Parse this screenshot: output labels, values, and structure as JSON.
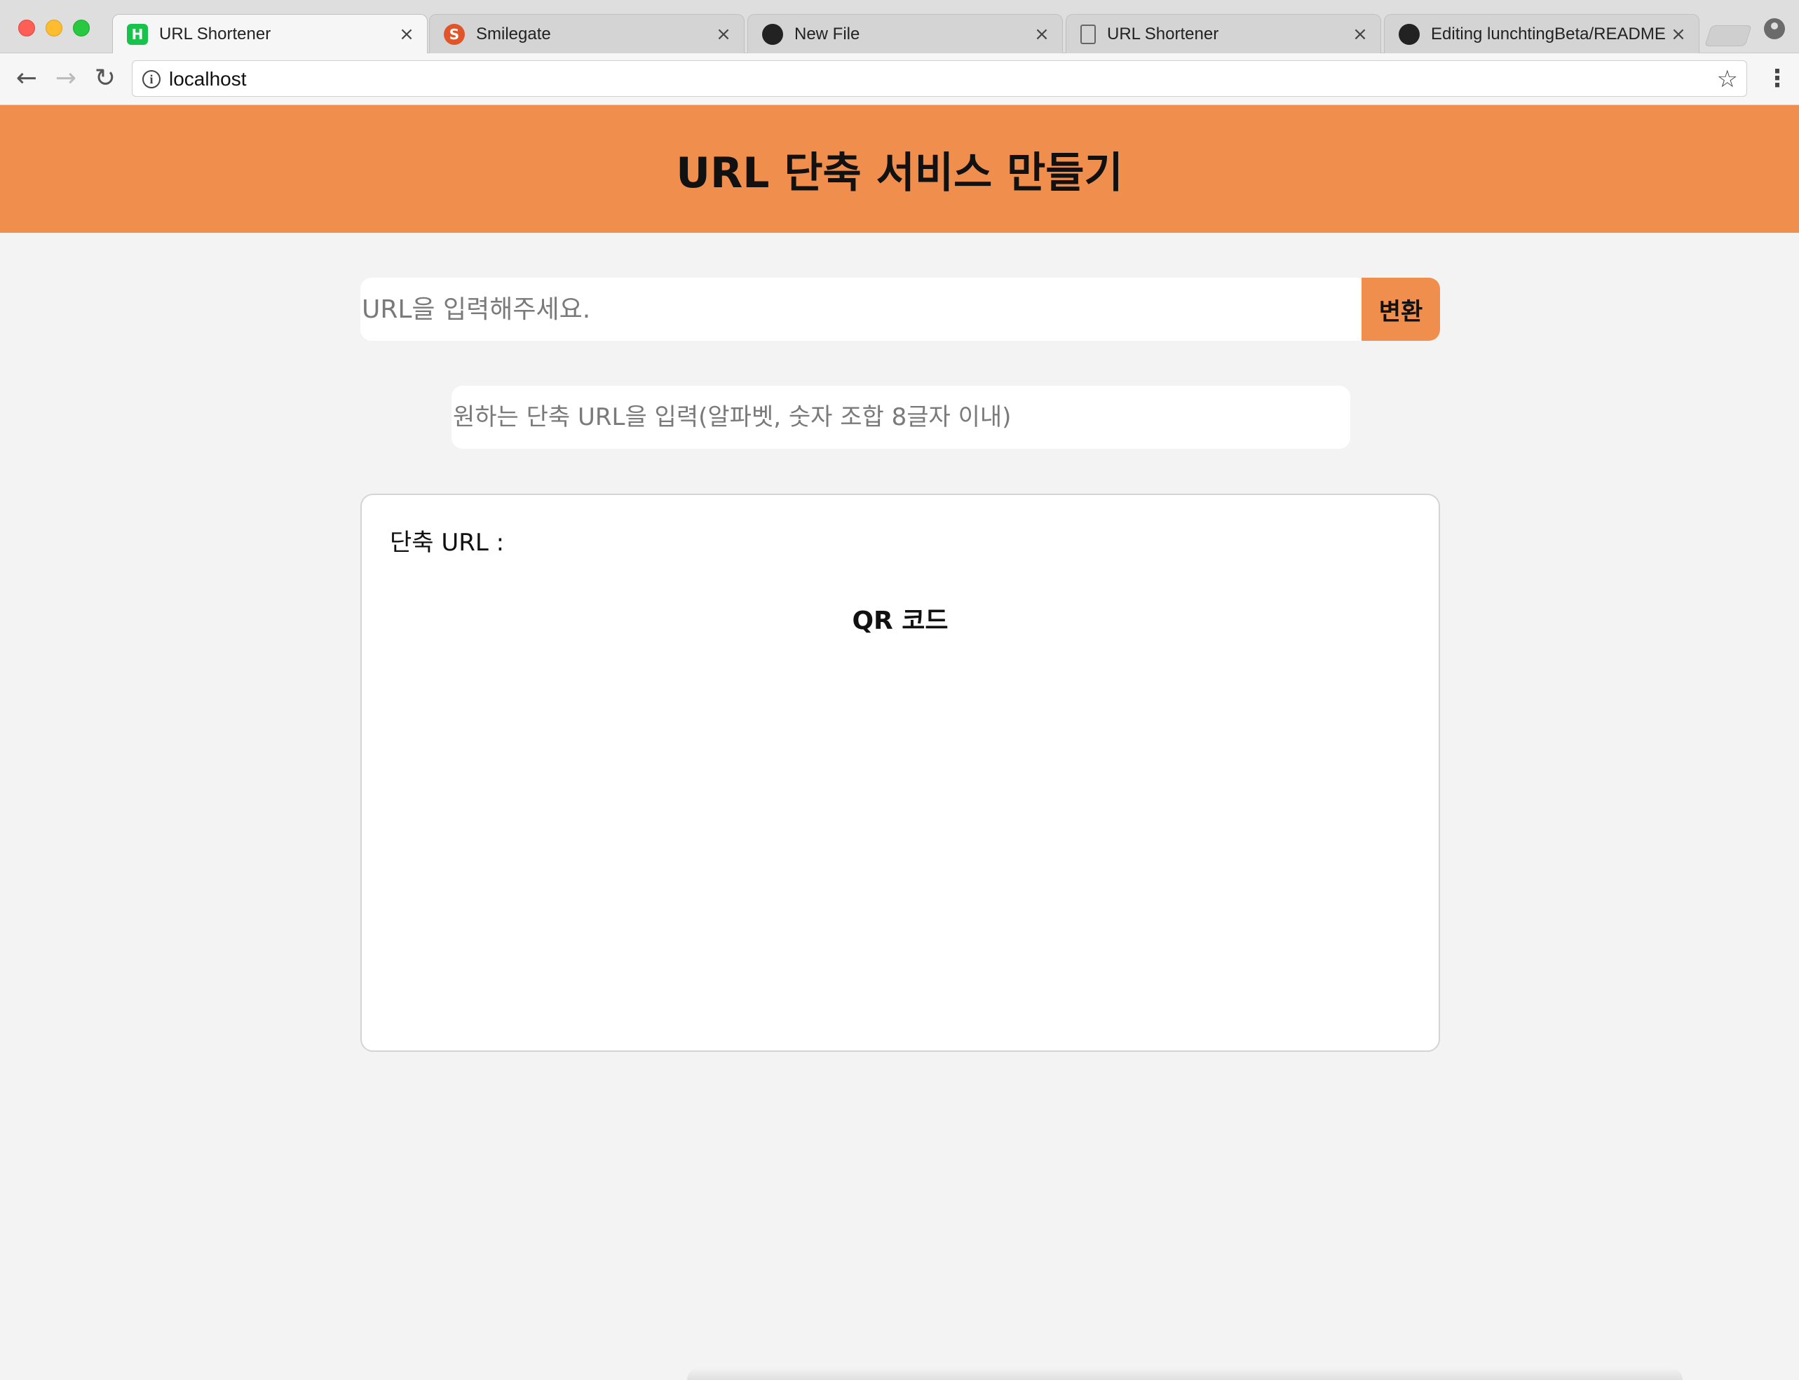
{
  "browser": {
    "tabs": [
      {
        "title": "URL Shortener",
        "favicon": "H"
      },
      {
        "title": "Smilegate",
        "favicon": "S"
      },
      {
        "title": "New File",
        "favicon": ""
      },
      {
        "title": "URL Shortener",
        "favicon": ""
      },
      {
        "title": "Editing lunchtingBeta/README",
        "favicon": ""
      }
    ],
    "tab_close_glyph": "×",
    "address": "localhost",
    "icons": {
      "back": "←",
      "forward": "→",
      "reload": "↻",
      "info": "i",
      "star": "☆",
      "menu": "⋮"
    }
  },
  "page": {
    "title": "URL 단축 서비스 만들기",
    "url_input_placeholder": "URL을 입력해주세요.",
    "convert_button": "변환",
    "custom_input_placeholder": "원하는 단축 URL을 입력(알파벳, 숫자 조합 8글자 이내)",
    "short_url_label": "단축 URL :",
    "qr_heading": "QR 코드",
    "accent_color": "#f08e4e"
  }
}
